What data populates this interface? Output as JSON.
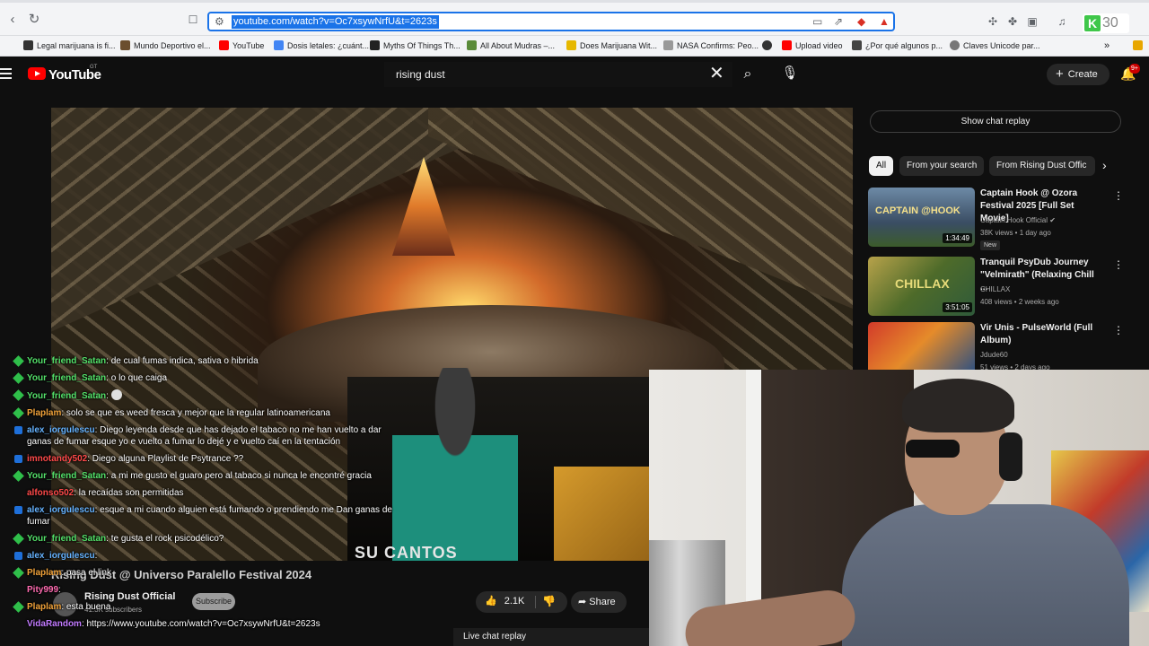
{
  "browser": {
    "url": "youtube.com/watch?v=Oc7xsywNrfU&t=2623s",
    "badge_number": "30",
    "bookmarks": [
      "Legal marijuana is fi...",
      "Mundo Deportivo el...",
      "YouTube",
      "Dosis letales: ¿cuánt...",
      "Myths Of Things Th...",
      "All About Mudras –...",
      "Does Marijuana Wit...",
      "NASA Confirms: Peo...",
      "Upload video",
      "¿Por qué algunos p...",
      "Claves Unicode par..."
    ]
  },
  "youtube": {
    "wordmark": "YouTube",
    "country": "GT",
    "search_query": "rising dust",
    "create_label": "Create",
    "notifications_badge": "9+"
  },
  "video": {
    "title": "Rising Dust @ Universo Paralello Festival 2024",
    "shirt_text": "SU CANTOS",
    "channel_name": "Rising Dust Official",
    "subscribers": "41.3K subscribers",
    "subscribe_label": "Subscribe",
    "likes": "2.1K",
    "share_label": "Share",
    "live_chat_replay_label": "Live chat replay"
  },
  "chat": [
    {
      "author": "Your_friend_Satan",
      "text": ": de cual fumas indica, sativa o hibrida",
      "color": "#54e16a",
      "badge": "green"
    },
    {
      "author": "Your_friend_Satan",
      "text": ": o lo que caiga",
      "color": "#54e16a",
      "badge": "green"
    },
    {
      "author": "Your_friend_Satan",
      "text": ":",
      "color": "#54e16a",
      "badge": "green",
      "emoji": true
    },
    {
      "author": "Plaplam",
      "text": ": solo se que es weed fresca y mejor que la regular latinoamericana",
      "color": "#f0a23a",
      "badge": "green"
    },
    {
      "author": "alex_iorgulescu",
      "text": ": Diego leyenda desde que has dejado el tabaco no me han vuelto a dar ganas de fumar esque yo e vuelto a fumar lo dejé y e vuelto caí en la tentación",
      "color": "#66b3ff",
      "badge": "blue"
    },
    {
      "author": "imnotandy502",
      "text": ": Diego alguna Playlist de Psytrance ??",
      "color": "#ff4a4a",
      "badge": "blue"
    },
    {
      "author": "Your_friend_Satan",
      "text": ": a mi me gusto el guaro pero al tabaco si nunca le encontré gracia",
      "color": "#54e16a",
      "badge": "green"
    },
    {
      "author": "alfonso502",
      "text": ": la recaídas son permitidas",
      "color": "#ff4a4a",
      "badge": "none"
    },
    {
      "author": "alex_iorgulescu",
      "text": ": esque a mi cuando alguien está fumando o prendiendo me Dan ganas de fumar",
      "color": "#66b3ff",
      "badge": "blue"
    },
    {
      "author": "Your_friend_Satan",
      "text": ": te gusta el rock psicodélico?",
      "color": "#54e16a",
      "badge": "green"
    },
    {
      "author": "alex_iorgulescu",
      "text": ":",
      "color": "#66b3ff",
      "badge": "blue"
    },
    {
      "author": "Plaplam",
      "text": ": pasa el link",
      "color": "#f0a23a",
      "badge": "green"
    },
    {
      "author": "Pity999",
      "text": ":",
      "color": "#ff6bb0",
      "badge": "none"
    },
    {
      "author": "Plaplam",
      "text": ": esta buena",
      "color": "#f0a23a",
      "badge": "green"
    },
    {
      "author": "VidaRandom",
      "text": ": https://www.youtube.com/watch?v=Oc7xsywNrfU&t=2623s",
      "color": "#c27bff",
      "badge": "none"
    }
  ],
  "sidebar": {
    "show_chat_replay": "Show chat replay",
    "chips": [
      "All",
      "From your search",
      "From Rising Dust Offic"
    ],
    "recommendations": [
      {
        "title": "Captain Hook @ Ozora Festival 2025 [Full Set Movie]",
        "channel": "Captain Hook Official",
        "meta": "38K views • 1 day ago",
        "duration": "1:34:49",
        "badge": "New",
        "thumb_label": "CAPTAIN @HOOK",
        "progress": 0
      },
      {
        "title": "Tranquil PsyDub Journey \"Velmirath\" (Relaxing Chill ...",
        "channel": "CHILLAX",
        "meta": "408 views • 2 weeks ago",
        "duration": "3:51:05",
        "badge": "",
        "thumb_label": "CHILLAX",
        "progress": 0
      },
      {
        "title": "Vir Unis - PulseWorld (Full Album)",
        "channel": "Jdude60",
        "meta": "51 views • 2 days ago",
        "duration": "",
        "badge": "",
        "thumb_label": "",
        "progress": 0
      }
    ]
  }
}
